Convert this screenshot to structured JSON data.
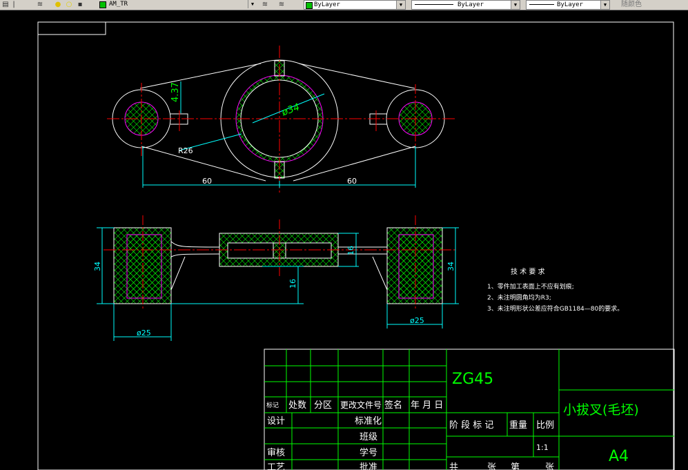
{
  "toolbar": {
    "layer_name": "AM_TR",
    "color_value": "ByLayer",
    "linetype_value": "ByLayer",
    "lineweight_value": "ByLayer",
    "plotstyle_value": "随颜色"
  },
  "drawing": {
    "dims": {
      "top_left_60": "60",
      "top_right_60": "60",
      "dia34": "ø34",
      "r26": "R26",
      "d437": "4.37",
      "side_34_left": "34",
      "side_34_right": "34",
      "side_16_right": "16",
      "side_16_mid": "16",
      "dia25_left": "ø25",
      "dia25_right": "ø25"
    },
    "tech": {
      "heading": "技 术 要 求",
      "line1": "1、零件加工表面上不应有划痕;",
      "line2": "2、未注明圆角均为R3;",
      "line3": "3、未注明形状公差应符合GB1184—80的要求。"
    },
    "title_block": {
      "material": "ZG45",
      "part_name": "小拔叉(毛坯)",
      "paper": "A4",
      "scale": "1:1",
      "h_mark": "标记",
      "h_count": "处数",
      "h_zone": "分区",
      "h_change_doc": "更改文件号",
      "h_sign": "签名",
      "h_date": "年 月 日",
      "design": "设计",
      "standardize": "标准化",
      "team": "班级",
      "student_id": "学号",
      "review": "审核",
      "process": "工艺",
      "approve": "批准",
      "stage_mark": "阶 段 标 记",
      "weight": "重量",
      "ratio": "比例",
      "total": "共",
      "sheets": "张",
      "page": "第",
      "sheet2": "张"
    }
  }
}
